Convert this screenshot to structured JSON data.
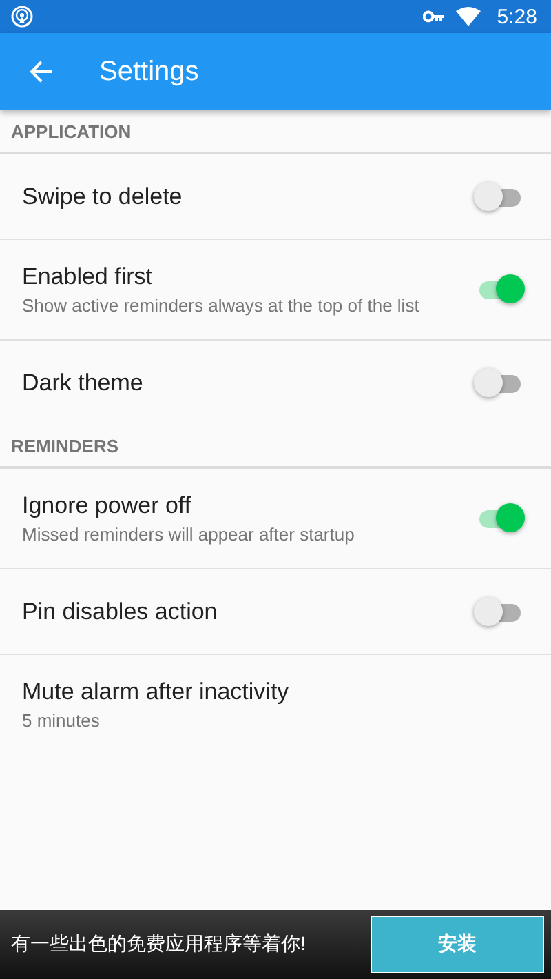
{
  "status_bar": {
    "time": "5:28"
  },
  "toolbar": {
    "title": "Settings"
  },
  "sections": [
    {
      "header": "APPLICATION",
      "items": [
        {
          "kind": "switch",
          "title": "Swipe to delete",
          "on": false
        },
        {
          "kind": "switch",
          "title": "Enabled first",
          "summary": "Show active reminders always at the top of the list",
          "on": true
        },
        {
          "kind": "switch",
          "title": "Dark theme",
          "on": false
        }
      ]
    },
    {
      "header": "REMINDERS",
      "items": [
        {
          "kind": "switch",
          "title": "Ignore power off",
          "summary": "Missed reminders will appear after startup",
          "on": true
        },
        {
          "kind": "switch",
          "title": "Pin disables action",
          "on": false
        },
        {
          "kind": "plain",
          "title": "Mute alarm after inactivity",
          "summary": "5 minutes"
        }
      ]
    }
  ],
  "ad_banner": {
    "text": "有一些出色的免费应用程序等着你!",
    "button": "安装"
  }
}
